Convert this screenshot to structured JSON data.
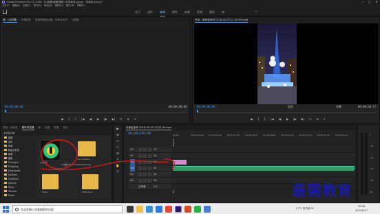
{
  "window": {
    "title": "Adobe Premiere Pro CC 2018 - D:\\视频\\视频\\视频 20\\未命名.prproj - 未命名.prproj *",
    "controls": [
      "─",
      "□",
      "✕"
    ]
  },
  "menu": [
    "文件(F)",
    "编辑(E)",
    "剪辑(C)",
    "序列(S)",
    "标记(M)",
    "图形(G)",
    "窗口(W)",
    "帮助(H)"
  ],
  "workspace_tabs": [
    "学习",
    "组件",
    "编辑",
    "颜色",
    "效果",
    "音频",
    "图形",
    "库"
  ],
  "workspace_active": "编辑",
  "workspace_more": "»",
  "source_monitor": {
    "tabs": [
      "源：(无剪辑)",
      "效果控件",
      "音频剪辑混合器：未命名序列",
      "元数据"
    ],
    "timecode_left": "00;00;00;00",
    "timecode_right": "00;00;00;00",
    "controls": [
      "◆",
      "{",
      "}",
      "|◀",
      "◀|",
      "▶",
      "|▶",
      "▶|",
      "⊡",
      "⊞",
      "+"
    ]
  },
  "program_monitor": {
    "tab": "节目：未命名序列 2018-05-03 12.52.40.mp4",
    "timecode_left": "00;00;00;00",
    "fit": "适合",
    "quality": "完整",
    "timecode_right": "00;00;36;17",
    "controls": [
      "◆",
      "{",
      "}",
      "|◀",
      "◀|",
      "▶",
      "|▶",
      "▶|",
      "⊡",
      "⊞",
      "+"
    ]
  },
  "project_panel": {
    "tabs": [
      "项目：未命名",
      "媒体浏览器",
      "库",
      "信息",
      "效果",
      "标记"
    ],
    "active_tab": "媒体浏览器",
    "path_label": "本地驱动器",
    "tree_items": [
      "视频",
      "素材",
      "声音",
      "新建文件夹",
      "音频",
      "图像",
      "ChengDu",
      "DingDing",
      "Downloads",
      "MeiTuan",
      "OneDrive",
      "QQLive",
      "Temp",
      "Tencent",
      "Users"
    ],
    "files": [
      {
        "name": "QQ音乐",
        "sub": "",
        "kind": "app"
      },
      {
        "name": "Documents",
        "sub": "",
        "kind": "folder"
      },
      {
        "name": "QQ图片20171122104530.jpg",
        "sub": "",
        "kind": "folder"
      },
      {
        "name": "Video",
        "sub": "",
        "kind": "folder"
      },
      {
        "name": "WPSCloud",
        "sub": "",
        "kind": "folder"
      }
    ]
  },
  "tools": [
    "▶",
    "⊕",
    "↔",
    "✂",
    "⊟",
    "✎",
    "✋",
    "T"
  ],
  "timeline": {
    "tab": "未命名序列 2018-05-03 12.52.40.mp4",
    "timecode": "00;00;00;00",
    "ruler_labels": [
      "00;00",
      "00;00;04;00",
      "00;00;08;00",
      "00;00;12;00",
      "00;00;16;00",
      "00;00;20;00",
      "00;00;24;00",
      "00;00;28;00",
      "00;00;32;00",
      "00;00;36;00"
    ],
    "tracks": [
      {
        "name": "V3",
        "kind": "video"
      },
      {
        "name": "V2",
        "kind": "video"
      },
      {
        "name": "V1",
        "kind": "video"
      },
      {
        "name": "A1",
        "kind": "audio"
      },
      {
        "name": "A2",
        "kind": "audio"
      },
      {
        "name": "A3",
        "kind": "audio"
      },
      {
        "name": "主声道",
        "kind": "master"
      }
    ],
    "master_value": "0.0",
    "clip_v1": "fx",
    "meter_db": [
      "0",
      "-12",
      "-24",
      "-36",
      "-48",
      "dB"
    ]
  },
  "taskbar": {
    "search_placeholder": "在这里输入你要搜索的内容",
    "weather": "27°C 空气良 51",
    "time": "22:08",
    "date": "2021/6/17"
  },
  "watermark": "最需教育",
  "colors": {
    "accent": "#4a8fe8",
    "annotation_red": "#e01818",
    "clip_pink": "#d98bd0",
    "audio_green": "#2d9b6a",
    "folder": "#e8b84a"
  }
}
